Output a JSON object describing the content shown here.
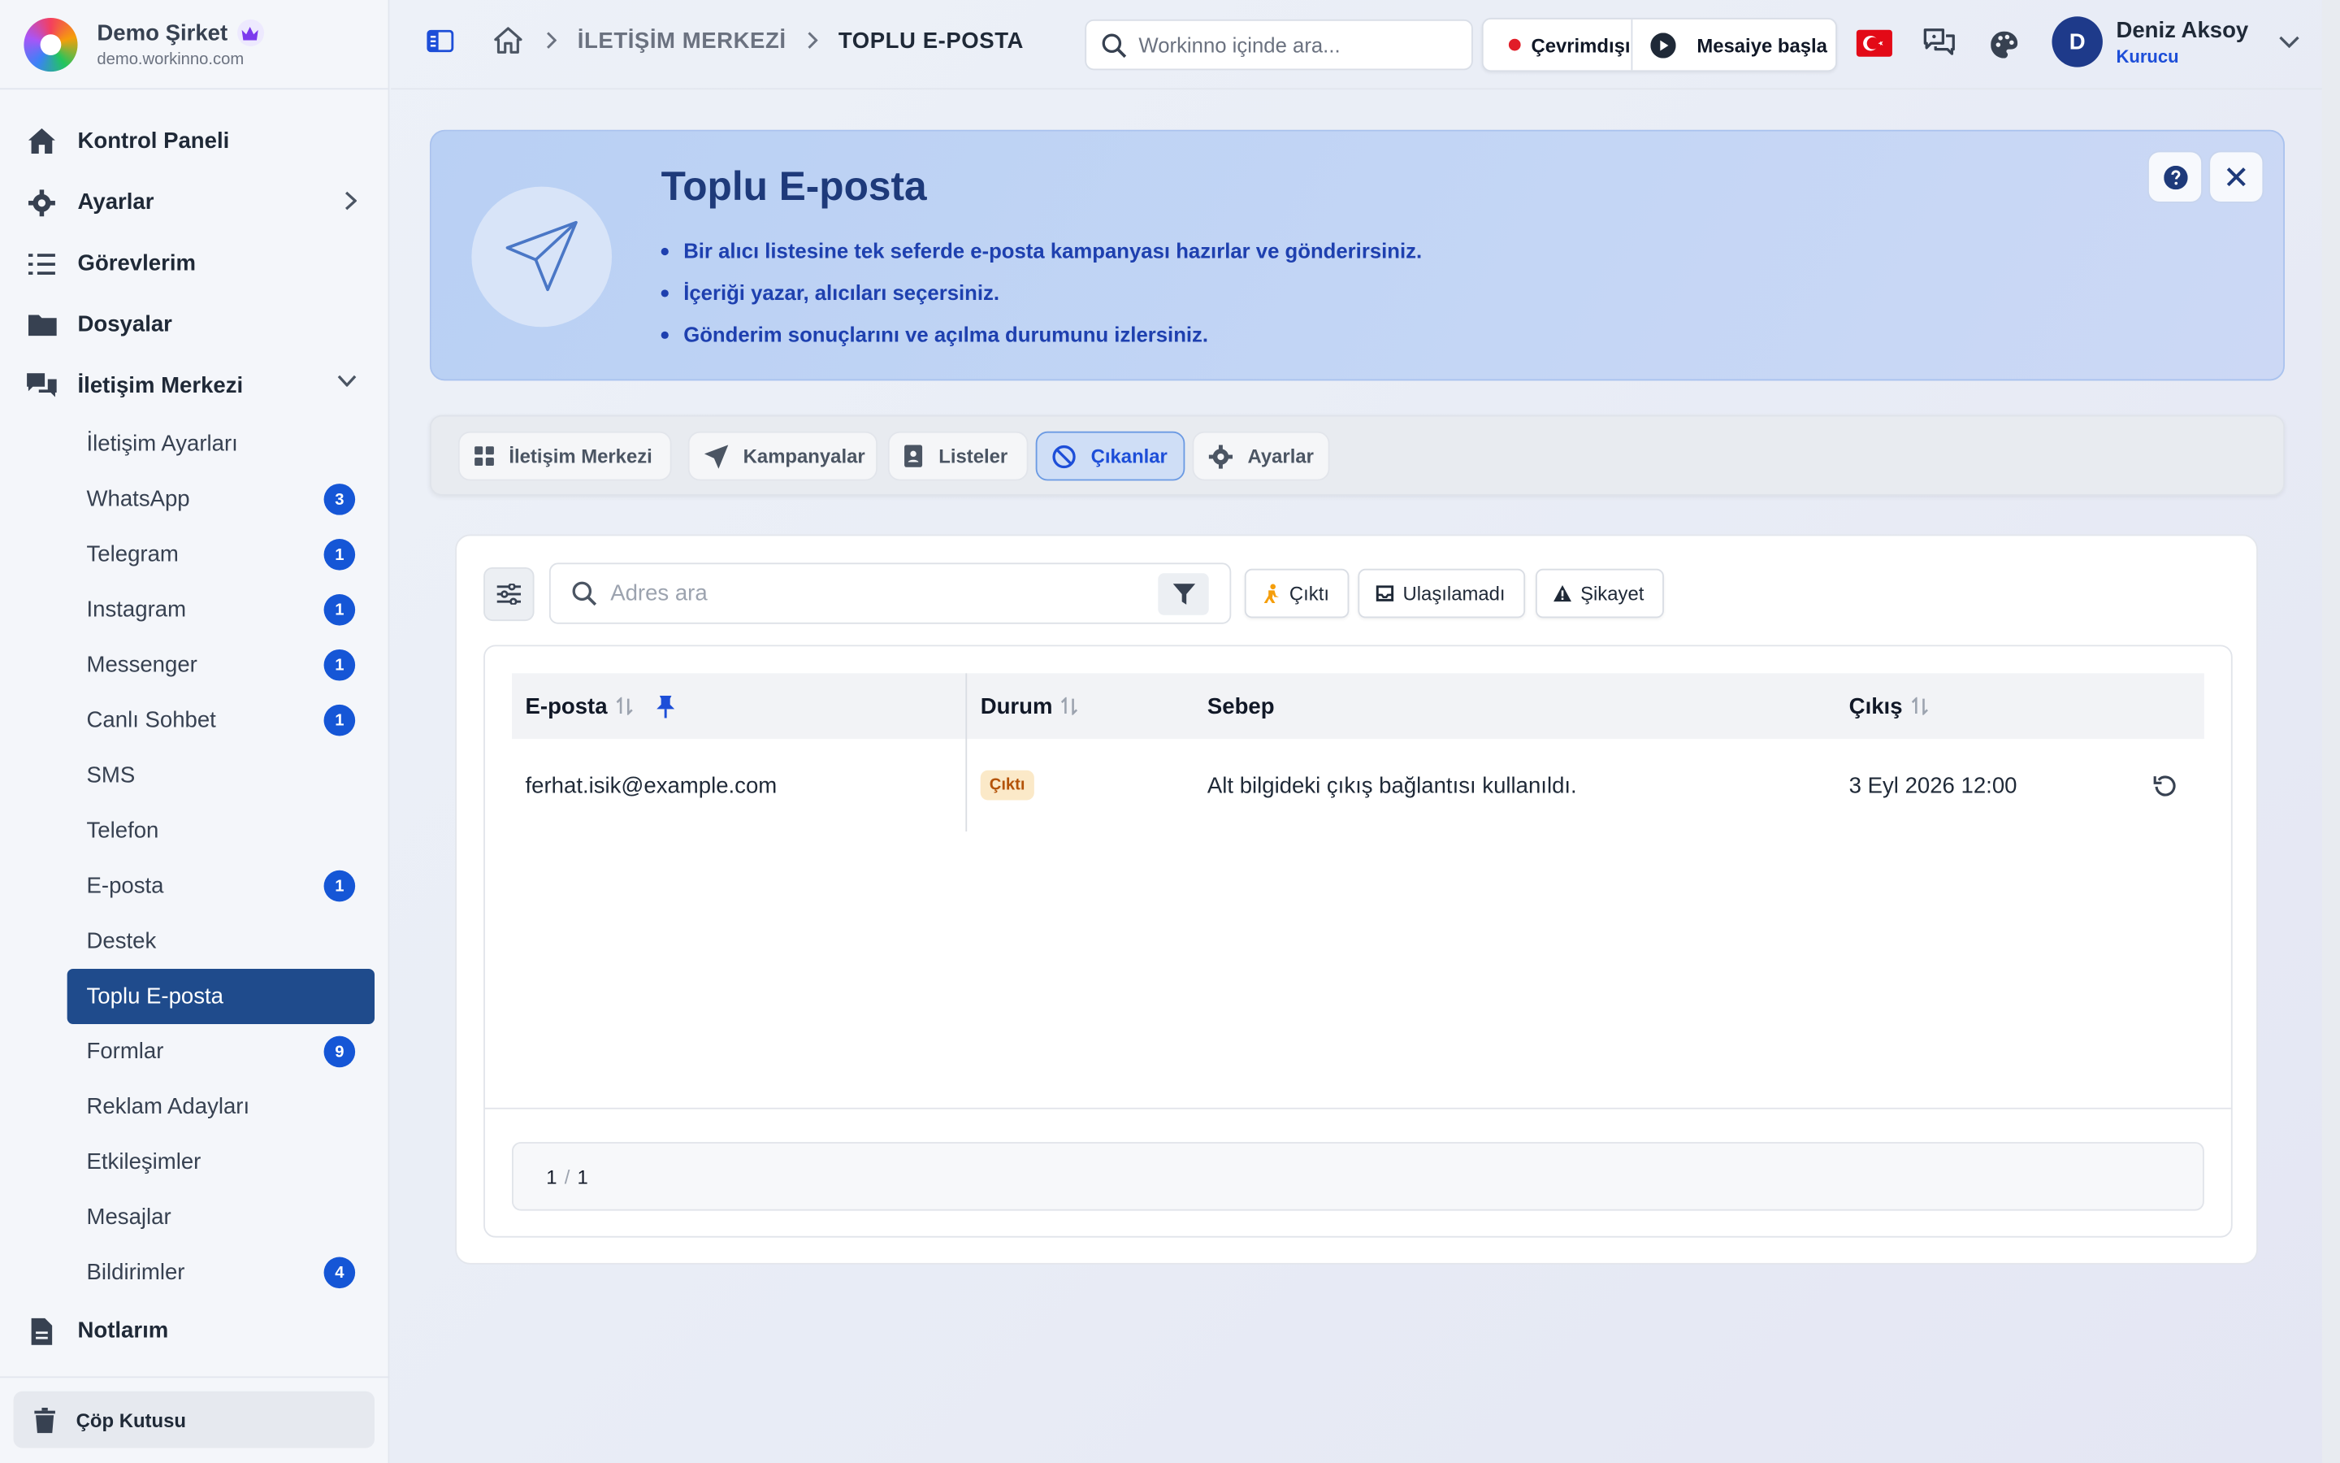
{
  "app": {
    "company": "Demo Şirket",
    "domain": "demo.workinno.com"
  },
  "sidebar": {
    "items": [
      {
        "label": "Kontrol Paneli",
        "icon": "home-icon"
      },
      {
        "label": "Ayarlar",
        "icon": "gear-icon"
      },
      {
        "label": "Görevlerim",
        "icon": "task-list-icon"
      },
      {
        "label": "Dosyalar",
        "icon": "folder-icon"
      },
      {
        "label": "İletişim Merkezi",
        "icon": "chat-bubbles-icon"
      }
    ],
    "sub_items": [
      {
        "label": "İletişim Ayarları",
        "badge": ""
      },
      {
        "label": "WhatsApp",
        "badge": "3"
      },
      {
        "label": "Telegram",
        "badge": "1"
      },
      {
        "label": "Instagram",
        "badge": "1"
      },
      {
        "label": "Messenger",
        "badge": "1"
      },
      {
        "label": "Canlı Sohbet",
        "badge": "1"
      },
      {
        "label": "SMS",
        "badge": ""
      },
      {
        "label": "Telefon",
        "badge": ""
      },
      {
        "label": "E-posta",
        "badge": "1"
      },
      {
        "label": "Destek",
        "badge": ""
      },
      {
        "label": "Toplu E-posta",
        "badge": ""
      },
      {
        "label": "Formlar",
        "badge": "9"
      },
      {
        "label": "Reklam Adayları",
        "badge": ""
      },
      {
        "label": "Etkileşimler",
        "badge": ""
      },
      {
        "label": "Mesajlar",
        "badge": ""
      },
      {
        "label": "Bildirimler",
        "badge": "4"
      }
    ],
    "active_sub": "Toplu E-posta",
    "notes": "Notlarım",
    "trash": "Çöp Kutusu"
  },
  "topbar": {
    "breadcrumb": [
      "İLETİŞİM MERKEZİ",
      "TOPLU E-POSTA"
    ],
    "search_placeholder": "Workinno içinde ara...",
    "status": "Çevrimdışı",
    "shift": "Mesaiye başla",
    "user_name": "Deniz Aksoy",
    "user_role": "Kurucu",
    "user_initial": "D"
  },
  "hero": {
    "title": "Toplu E-posta",
    "bullets": [
      "Bir alıcı listesine tek seferde e-posta kampanyası hazırlar ve gönderirsiniz.",
      "İçeriği yazar, alıcıları seçersiniz.",
      "Gönderim sonuçlarını ve açılma durumunu izlersiniz."
    ]
  },
  "tabs": [
    {
      "label": "İletişim Merkezi",
      "icon": "grid-icon"
    },
    {
      "label": "Kampanyalar",
      "icon": "send-icon"
    },
    {
      "label": "Listeler",
      "icon": "contact-book-icon"
    },
    {
      "label": "Çıkanlar",
      "icon": "ban-icon"
    },
    {
      "label": "Ayarlar",
      "icon": "gear-icon"
    }
  ],
  "active_tab": "Çıkanlar",
  "toolbar": {
    "search_placeholder": "Adres ara",
    "chips": [
      "Çıktı",
      "Ulaşılamadı",
      "Şikayet"
    ]
  },
  "table": {
    "headers": [
      "E-posta",
      "Durum",
      "Sebep",
      "Çıkış"
    ],
    "rows": [
      {
        "email": "ferhat.isik@example.com",
        "status": "Çıktı",
        "reason": "Alt bilgideki çıkış bağlantısı kullanıldı.",
        "date": "3 Eyl 2026 12:00"
      }
    ],
    "pager": {
      "current": "1",
      "total": "1"
    }
  },
  "colors": {
    "accent": "#1556d6",
    "active_nav": "#1f4b8c",
    "status_offline": "#e11d28",
    "hero_title": "#1e3a7a"
  }
}
